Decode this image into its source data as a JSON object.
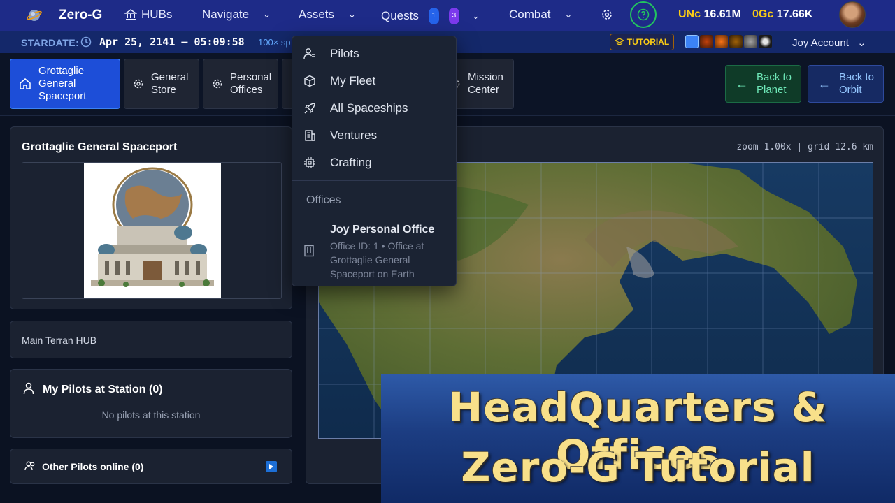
{
  "app": {
    "brand": "Zero-G"
  },
  "nav": {
    "hubs": "HUBs",
    "navigate": "Navigate",
    "assets": "Assets",
    "quests": "Quests",
    "quests_badge_1": "1",
    "quests_badge_2": "3",
    "combat": "Combat"
  },
  "currencies": [
    {
      "name": "UNc",
      "value": "16.61M"
    },
    {
      "name": "0Gc",
      "value": "17.66K"
    }
  ],
  "stardate": {
    "label": "STARDATE:",
    "value": "Apr 25, 2141 — 05:09:58",
    "speed": "100× sp"
  },
  "tutorial_label": "TUTORIAL",
  "account_label": "Joy Account",
  "hub_tabs": [
    {
      "label": "Grottaglie General Spaceport",
      "icon": "home-icon",
      "active": true
    },
    {
      "label": "General Store",
      "icon": "gear-icon"
    },
    {
      "label": "Personal Offices",
      "icon": "gear-icon"
    },
    {
      "label": "",
      "icon": "gear-icon"
    },
    {
      "label": "Mission Center",
      "icon": "gear-icon"
    }
  ],
  "back_buttons": {
    "planet": "Back to Planet",
    "orbit": "Back to Orbit"
  },
  "spaceport": {
    "title": "Grottaglie General Spaceport"
  },
  "hub_note": "Main Terran HUB",
  "pilots": {
    "title": "My Pilots at Station (0)",
    "empty": "No pilots at this station"
  },
  "others": {
    "title": "Other Pilots online (0)"
  },
  "map": {
    "readout": "zoom 1.00x  |  grid 12.6 km"
  },
  "dropdown": {
    "items": [
      {
        "label": "Pilots",
        "icon": "pilot-icon"
      },
      {
        "label": "My Fleet",
        "icon": "cube-icon"
      },
      {
        "label": "All Spaceships",
        "icon": "rocket-icon"
      },
      {
        "label": "Ventures",
        "icon": "building-icon"
      },
      {
        "label": "Crafting",
        "icon": "chip-icon"
      }
    ],
    "section": "Offices",
    "office": {
      "name": "Joy Personal Office",
      "desc": "Office ID: 1 • Office at Grottaglie General Spaceport on Earth"
    }
  },
  "banner": {
    "line1": "HeadQuarters & Offices",
    "line2": "Zero-G Tutorial"
  },
  "colors": {
    "nav_bg": "#1e2b88",
    "accent_blue": "#1d4ed8",
    "currency_yellow": "#facc15",
    "help_green": "#22c55e"
  }
}
